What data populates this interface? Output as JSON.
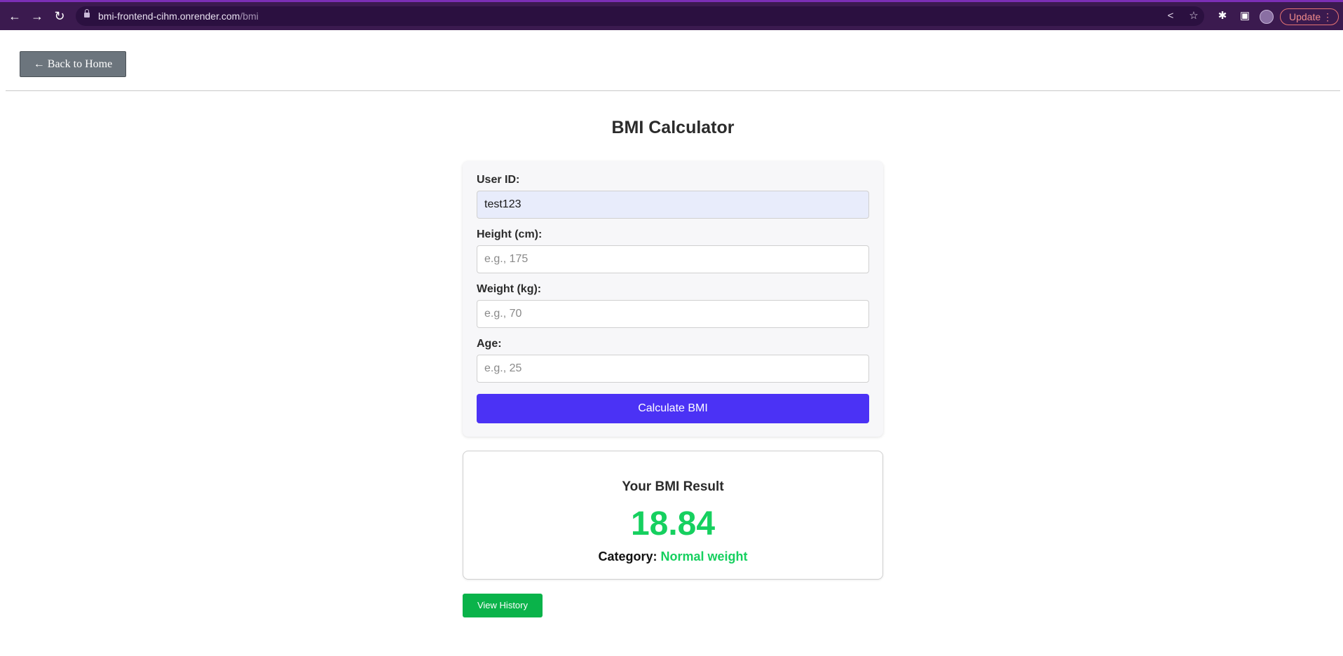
{
  "browser": {
    "url_host": "bmi-frontend-cihm.onrender.com",
    "url_path": "/bmi",
    "update_label": "Update",
    "accent_color": "#3b1a4f"
  },
  "page": {
    "back_label": "← Back to Home",
    "title": "BMI Calculator"
  },
  "form": {
    "user_id_label": "User ID:",
    "user_id_value": "test123",
    "height_label": "Height (cm):",
    "height_placeholder": "e.g., 175",
    "weight_label": "Weight (kg):",
    "weight_placeholder": "e.g., 70",
    "age_label": "Age:",
    "age_placeholder": "e.g., 25",
    "submit_label": "Calculate BMI",
    "submit_color": "#4b32f5"
  },
  "result": {
    "heading": "Your BMI Result",
    "bmi": "18.84",
    "category_label": "Category:",
    "category_value": "Normal weight",
    "value_color": "#16d05f"
  },
  "history": {
    "label": "View History",
    "color": "#0ab34a"
  }
}
